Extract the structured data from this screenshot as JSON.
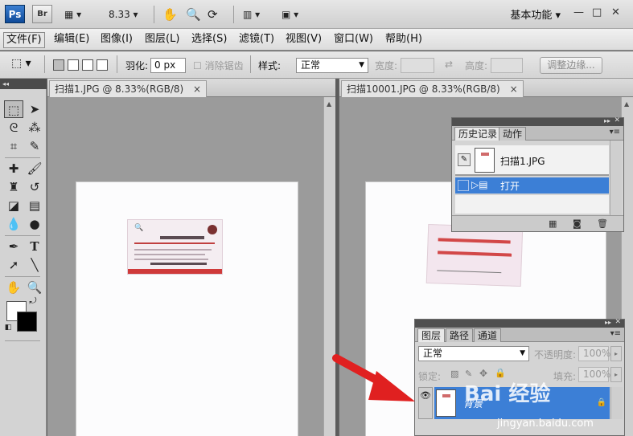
{
  "appbar": {
    "ps_logo": "Ps",
    "br_logo": "Br",
    "zoom": "8.33",
    "workspace": "基本功能",
    "window_min": "—",
    "window_restore": "□",
    "window_close": "✕"
  },
  "menubar": {
    "items": [
      "文件(F)",
      "编辑(E)",
      "图像(I)",
      "图层(L)",
      "选择(S)",
      "滤镜(T)",
      "视图(V)",
      "窗口(W)",
      "帮助(H)"
    ]
  },
  "options": {
    "feather_label": "羽化:",
    "feather_value": "0 px",
    "antialias_label": "消除锯齿",
    "style_label": "样式:",
    "style_value": "正常",
    "width_label": "宽度:",
    "height_label": "高度:",
    "refine_edge": "调整边缘..."
  },
  "documents": [
    {
      "tab_title": "扫描1.JPG @ 8.33%(RGB/8)",
      "close": "×"
    },
    {
      "tab_title": "扫描10001.JPG @ 8.33%(RGB/8)",
      "close": "×"
    }
  ],
  "history_panel": {
    "tabs": [
      "历史记录",
      "动作"
    ],
    "snapshot_name": "扫描1.JPG",
    "steps": [
      "打开"
    ]
  },
  "layers_panel": {
    "tabs": [
      "图层",
      "路径",
      "通道"
    ],
    "blend_mode": "正常",
    "opacity_label": "不透明度:",
    "opacity_value": "100%",
    "lock_label": "锁定:",
    "fill_label": "填充:",
    "fill_value": "100%",
    "layers": [
      {
        "name": "背景"
      }
    ]
  },
  "watermark": {
    "logo": "Bai 经验",
    "url": "jingyan.baidu.com"
  },
  "colors": {
    "accent_blue": "#3c7fd6",
    "arrow_red": "#e02020",
    "card_red": "#cf3a3a"
  }
}
